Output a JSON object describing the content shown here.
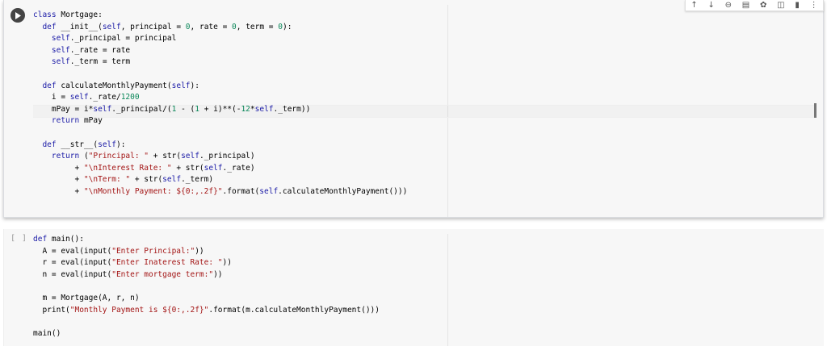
{
  "toolbar": {
    "icons": [
      "move-up-icon",
      "move-down-icon",
      "link-icon",
      "comment-icon",
      "settings-icon",
      "mirror-cell-icon",
      "delete-icon",
      "more-icon"
    ]
  },
  "cell1": {
    "lines": [
      "class Mortgage:",
      "  def __init__(self, principal = 0, rate = 0, term = 0):",
      "    self._principal = principal",
      "    self._rate = rate",
      "    self._term = term",
      "",
      "  def calculateMonthlyPayment(self):",
      "    i = self._rate/1200",
      "    mPay = i*self._principal/(1 - (1 + i)**(-12*self._term))",
      "    return mPay",
      "",
      "  def __str__(self):",
      "    return (\"Principal: \" + str(self._principal)",
      "         + \"\\nInterest Rate: \" + str(self._rate)",
      "         + \"\\nTerm: \" + str(self._term)",
      "         + \"\\nMonthly Payment: ${0:,.2f}\".format(self.calculateMonthlyPayment()))"
    ]
  },
  "cell2": {
    "exec_count": "[ ]",
    "lines": [
      "def main():",
      "  A = eval(input(\"Enter Principal:\"))",
      "  r = eval(input(\"Enter Inaterest Rate: \"))",
      "  n = eval(input(\"Enter mortgage term:\"))",
      "",
      "  m = Mortgage(A, r, n)",
      "  print(\"Monthly Payment is ${0:,.2f}\".format(m.calculateMonthlyPayment()))",
      "",
      "main()"
    ]
  },
  "colors": {
    "keyword": "#1a1aa6",
    "string": "#a31515",
    "number": "#098658",
    "cell_bg": "#f7f7f7"
  }
}
